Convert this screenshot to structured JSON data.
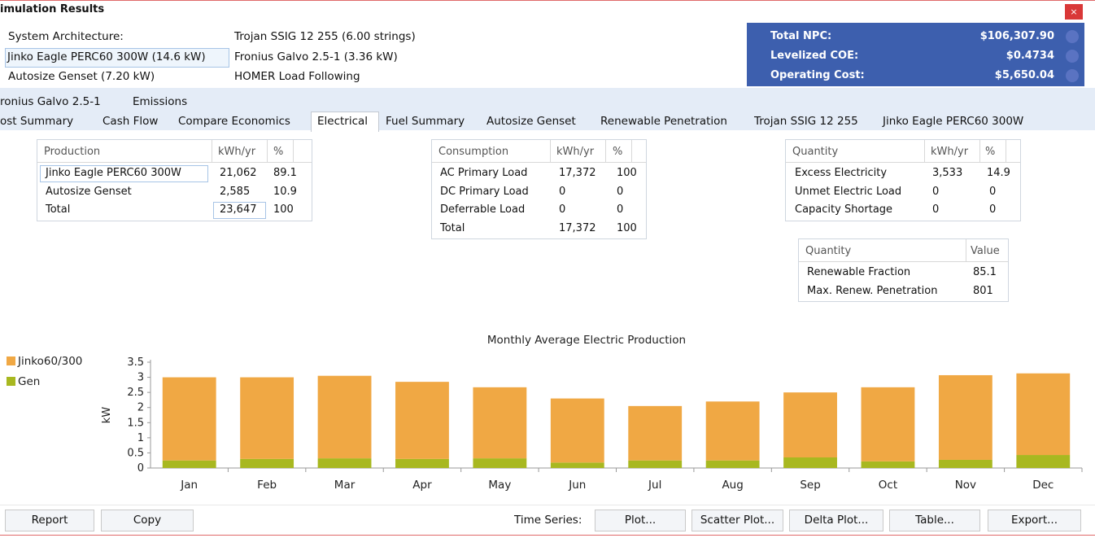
{
  "window": {
    "title": "imulation Results",
    "close": "×"
  },
  "architecture": {
    "label": "System Architecture:",
    "pv": "Jinko Eagle PERC60 300W (14.6 kW)",
    "genset": "Autosize Genset (7.20 kW)",
    "battery": "Trojan SSIG 12 255 (6.00 strings)",
    "converter": "Fronius Galvo 2.5-1 (3.36 kW)",
    "dispatch": "HOMER Load Following"
  },
  "summary": [
    {
      "label": "Total NPC:",
      "value": "$106,307.90"
    },
    {
      "label": "Levelized COE:",
      "value": "$0.4734"
    },
    {
      "label": "Operating Cost:",
      "value": "$5,650.04"
    }
  ],
  "tabs_row1": [
    "ronius Galvo 2.5-1",
    "Emissions"
  ],
  "tabs_row2": [
    "ost Summary",
    "Cash Flow",
    "Compare Economics",
    "Electrical",
    "Fuel Summary",
    "Autosize Genset",
    "Renewable Penetration",
    "Trojan SSIG 12 255",
    "Jinko Eagle PERC60 300W"
  ],
  "production": {
    "headers": [
      "Production",
      "kWh/yr",
      "%"
    ],
    "rows": [
      [
        "Jinko Eagle PERC60 300W",
        "21,062",
        "89.1"
      ],
      [
        "Autosize Genset",
        "2,585",
        "10.9"
      ],
      [
        "Total",
        "23,647",
        "100"
      ]
    ]
  },
  "consumption": {
    "headers": [
      "Consumption",
      "kWh/yr",
      "%"
    ],
    "rows": [
      [
        "AC Primary Load",
        "17,372",
        "100"
      ],
      [
        "DC Primary Load",
        "0",
        "0"
      ],
      [
        "Deferrable Load",
        "0",
        "0"
      ],
      [
        "Total",
        "17,372",
        "100"
      ]
    ]
  },
  "quantity": {
    "headers": [
      "Quantity",
      "kWh/yr",
      "%"
    ],
    "rows": [
      [
        "Excess Electricity",
        "3,533",
        "14.9"
      ],
      [
        "Unmet Electric Load",
        "0",
        "0"
      ],
      [
        "Capacity Shortage",
        "0",
        "0"
      ]
    ]
  },
  "renewable": {
    "headers": [
      "Quantity",
      "Value"
    ],
    "rows": [
      [
        "Renewable Fraction",
        "85.1"
      ],
      [
        "Max. Renew. Penetration",
        "801"
      ]
    ]
  },
  "chart_data": {
    "type": "bar",
    "stacked": true,
    "title": "Monthly Average Electric Production",
    "xlabel": "",
    "ylabel": "kW",
    "ylim": [
      0,
      3.5
    ],
    "yticks": [
      "0",
      "0.5",
      "1",
      "1.5",
      "2",
      "2.5",
      "3",
      "3.5"
    ],
    "categories": [
      "Jan",
      "Feb",
      "Mar",
      "Apr",
      "May",
      "Jun",
      "Jul",
      "Aug",
      "Sep",
      "Oct",
      "Nov",
      "Dec"
    ],
    "series": [
      {
        "name": "Gen",
        "color": "#a8b820",
        "values": [
          0.25,
          0.3,
          0.32,
          0.3,
          0.32,
          0.18,
          0.25,
          0.25,
          0.35,
          0.22,
          0.27,
          0.43
        ]
      },
      {
        "name": "Jinko60/300",
        "color": "#f0a844",
        "values": [
          2.75,
          2.7,
          2.73,
          2.55,
          2.35,
          2.12,
          1.8,
          1.95,
          2.15,
          2.45,
          2.8,
          2.7
        ]
      }
    ],
    "legend": "top-left",
    "grid": false
  },
  "buttons": {
    "report": "Report",
    "copy": "Copy",
    "time_series_label": "Time Series:",
    "plot": "Plot...",
    "scatter": "Scatter Plot...",
    "delta": "Delta Plot...",
    "table": "Table...",
    "export": "Export..."
  }
}
